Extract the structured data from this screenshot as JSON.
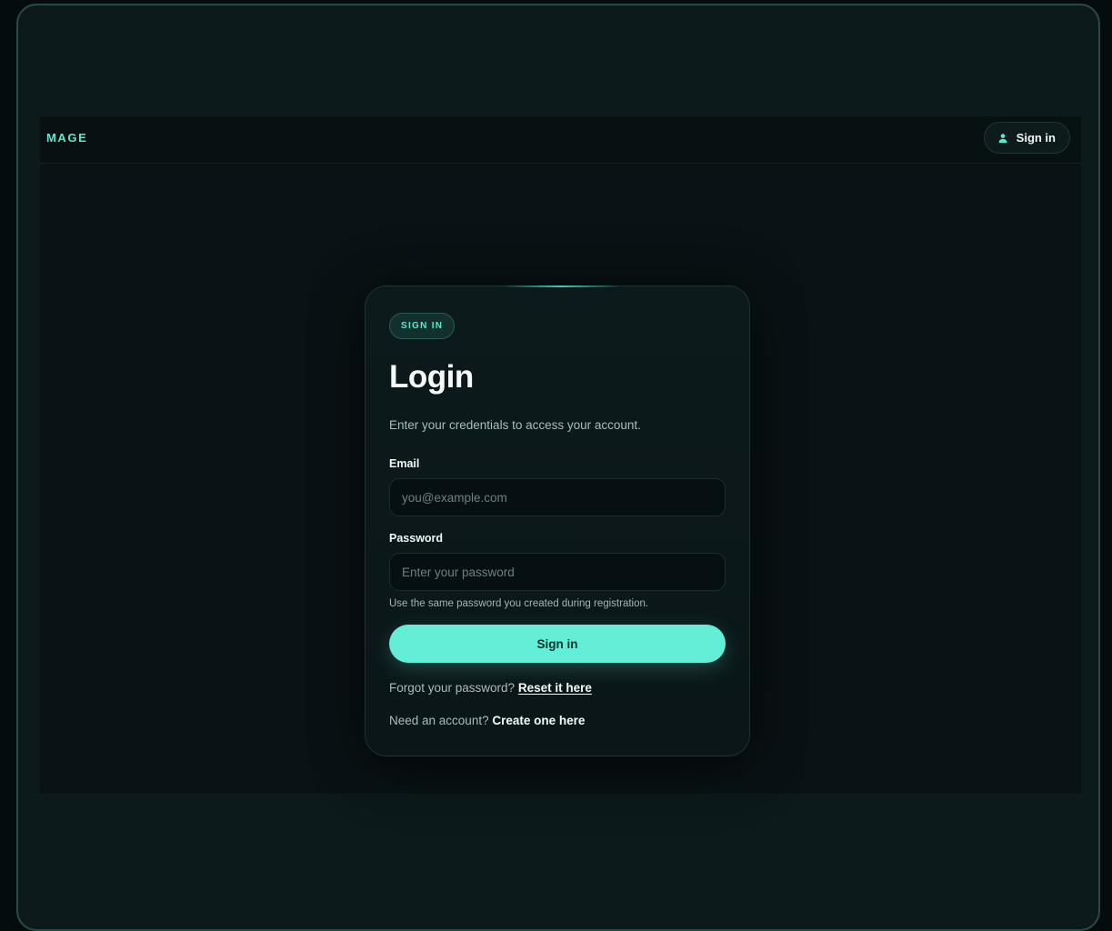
{
  "navbar": {
    "brand": "MAGE",
    "signin_label": "Sign in",
    "signin_icon": "user-icon"
  },
  "card": {
    "badge": "SIGN IN",
    "title": "Login",
    "subtitle": "Enter your credentials to access your account.",
    "email": {
      "label": "Email",
      "placeholder": "you@example.com",
      "value": ""
    },
    "password": {
      "label": "Password",
      "placeholder": "Enter your password",
      "value": "",
      "hint": "Use the same password you created during registration."
    },
    "submit_label": "Sign in",
    "forgot": {
      "prefix": "Forgot your password? ",
      "link": "Reset it here"
    },
    "register": {
      "prefix": "Need an account? ",
      "link": "Create one here"
    }
  },
  "colors": {
    "accent": "#63efd7",
    "background": "#091315",
    "card": "#0d1a1c"
  }
}
